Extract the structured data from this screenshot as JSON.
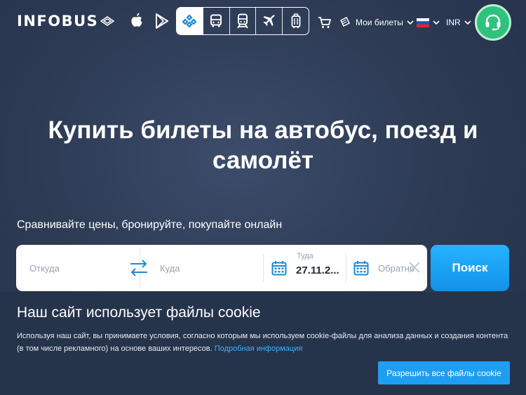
{
  "header": {
    "logo_text": "INFOBUS",
    "my_tickets": "Мои билеты",
    "currency": "INR"
  },
  "icons": {
    "apple": "apple-icon",
    "google_play": "google-play-icon",
    "transport": [
      "all-transport-icon",
      "bus-icon",
      "train-icon",
      "plane-icon",
      "luggage-icon"
    ],
    "cart": "cart-icon",
    "tickets": "ticket-icon",
    "flag": "russia-flag-icon",
    "support": "headset-icon",
    "swap": "swap-arrows-icon",
    "calendar": "calendar-icon",
    "clear": "close-icon"
  },
  "hero": {
    "title": "Купить билеты на автобус, поезд и самолёт",
    "subtitle": "Сравнивайте цены, бронируйте, покупайте онлайн"
  },
  "search": {
    "from_placeholder": "Откуда",
    "to_placeholder": "Куда",
    "depart_label": "Туда",
    "depart_value": "27.11.2...",
    "return_placeholder": "Обратно",
    "button": "Поиск"
  },
  "cookie": {
    "title": "Наш сайт использует файлы cookie",
    "text": "Используя наш сайт, вы принимаете условия, согласно которым мы используем cookie-файлы для анализа данных и создания контента (в том числе рекламного) на основе ваших интересов. ",
    "link": "Подробная информация",
    "accept": "Разрешить все файлы cookie"
  },
  "colors": {
    "accent": "#1e9ef1",
    "support": "#2ec27e",
    "calendar": "#1b8ad6",
    "link": "#3bb3ff"
  }
}
